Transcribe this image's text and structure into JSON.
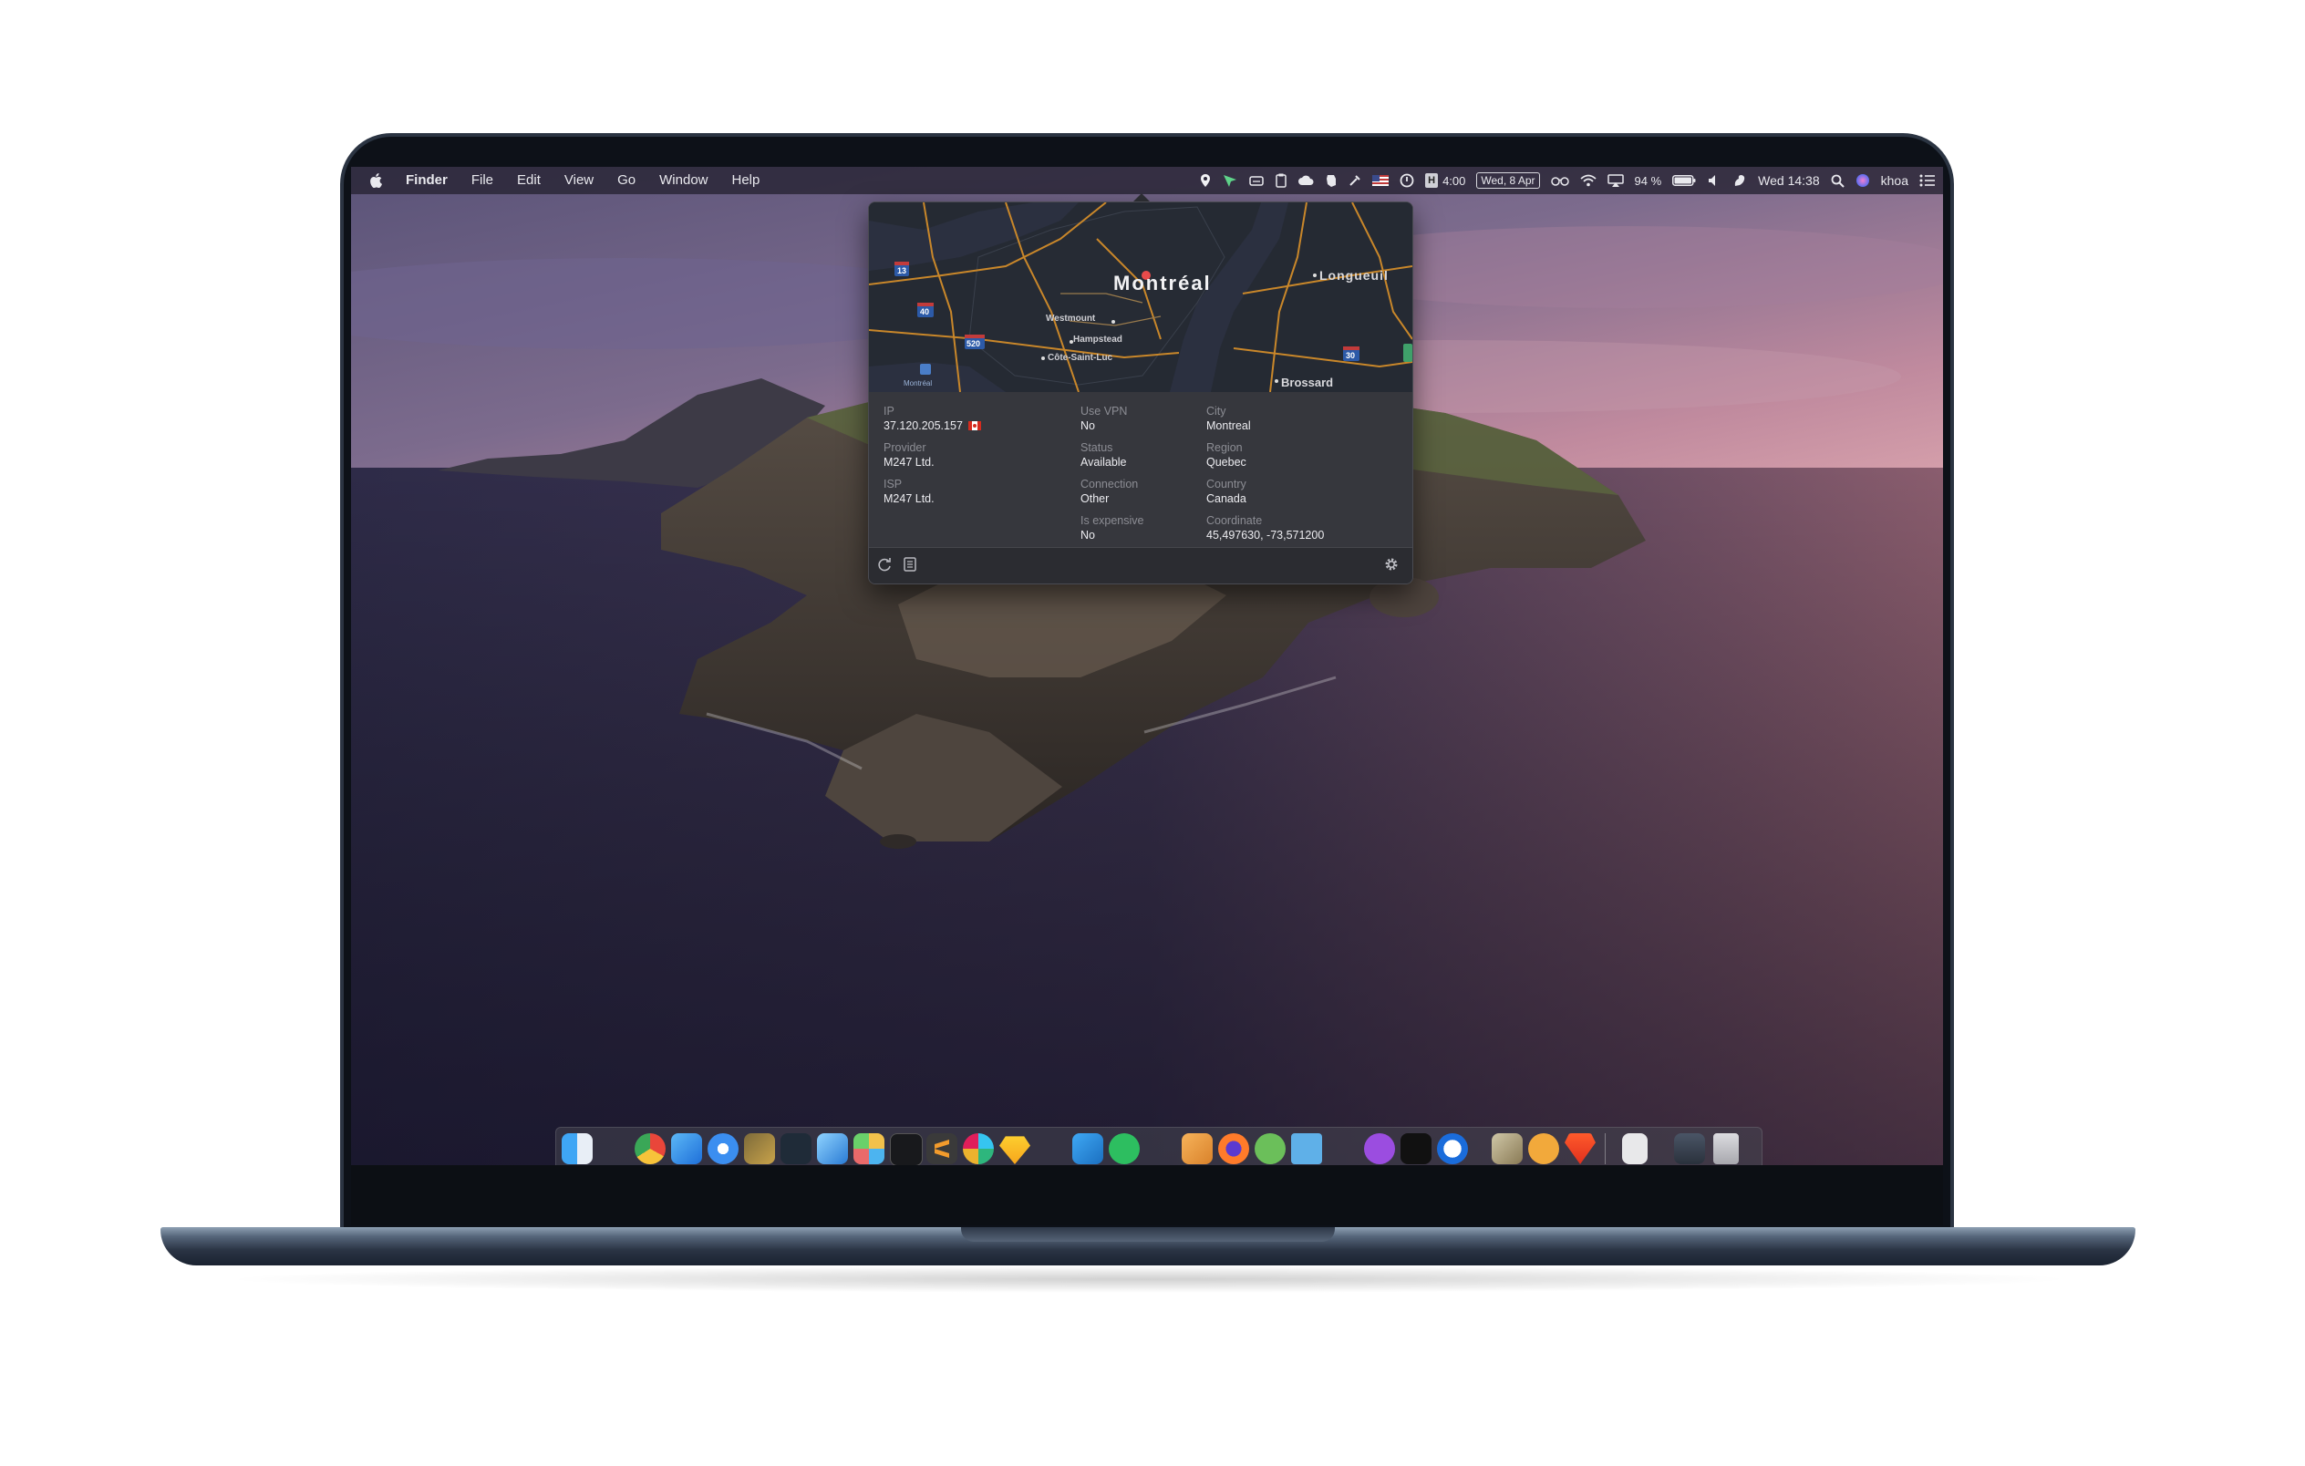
{
  "menubar": {
    "apple": "",
    "app_name": "Finder",
    "menus": [
      "File",
      "Edit",
      "View",
      "Go",
      "Window",
      "Help"
    ],
    "timer_badge": "H",
    "timer": "4:00",
    "date_pill": "Wed, 8 Apr",
    "battery": "94 %",
    "clock": "Wed 14:38",
    "user": "khoa"
  },
  "popover": {
    "map_labels": {
      "city": "Montréal",
      "longueuil": "Longueuil",
      "westmount": "Westmount",
      "hampstead": "Hampstead",
      "cote": "Côte-Saint-Luc",
      "brossard": "Brossard",
      "montreal_small": "Montréal",
      "route13": "13",
      "route40": "40",
      "route520": "520",
      "route30": "30"
    },
    "ip_label": "IP",
    "ip": "37.120.205.157",
    "provider_label": "Provider",
    "provider": "M247 Ltd.",
    "isp_label": "ISP",
    "isp": "M247 Ltd.",
    "vpn_label": "Use VPN",
    "vpn": "No",
    "status_label": "Status",
    "status": "Available",
    "connection_label": "Connection",
    "connection": "Other",
    "expensive_label": "Is expensive",
    "expensive": "No",
    "city_label": "City",
    "city": "Montreal",
    "region_label": "Region",
    "region": "Quebec",
    "country_label": "Country",
    "country": "Canada",
    "coord_label": "Coordinate",
    "coord": "45,497630, -73,571200"
  },
  "colors": {
    "popover_bg": "#2f3036",
    "info_bg": "#36373d",
    "map_road": "#c9872a",
    "map_water": "#2b3040"
  }
}
